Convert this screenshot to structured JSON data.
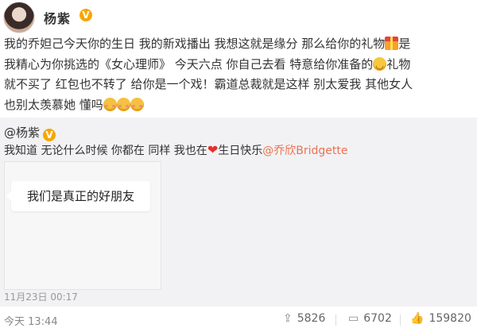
{
  "header": {
    "username": "杨紫",
    "verified_badge": "V"
  },
  "post": {
    "lines": [
      [
        "我的乔妲己今天你的生日 我的新戏播出 我想这就是缘分 那么给你的礼物",
        {
          "emoji": "gift-emoji"
        },
        "是"
      ],
      [
        "我精心为你挑选的《女心理师》 今天六点 你自己去看 特意给你准备的",
        {
          "emoji": "smile-emoji"
        },
        "礼物"
      ],
      [
        "就不买了 红包也不转了 给你是一个戏！霸道总裁就是这样 别太爱我 其他女人"
      ],
      [
        "也别太羡慕她 懂吗",
        {
          "emoji": "blush-emoji"
        },
        {
          "emoji": "blush-emoji"
        },
        {
          "emoji": "blush-emoji"
        }
      ]
    ]
  },
  "repost": {
    "author": "@杨紫",
    "text_before_heart": "我知道 无论什么时候 你都在 同样 我也在",
    "heart_icon": "heart-icon",
    "text_after_heart": "生日快乐",
    "mention": "@乔欣Bridgette",
    "image_caption": "我们是真正的好朋友",
    "time": "11月23日 00:17"
  },
  "footer": {
    "time": "今天 13:44",
    "reposts": "5826",
    "comments": "6702",
    "likes": "159820"
  },
  "colors": {
    "accent": "#eb7350",
    "badge": "#f7a600",
    "repost_bg": "#f2f2f5"
  }
}
